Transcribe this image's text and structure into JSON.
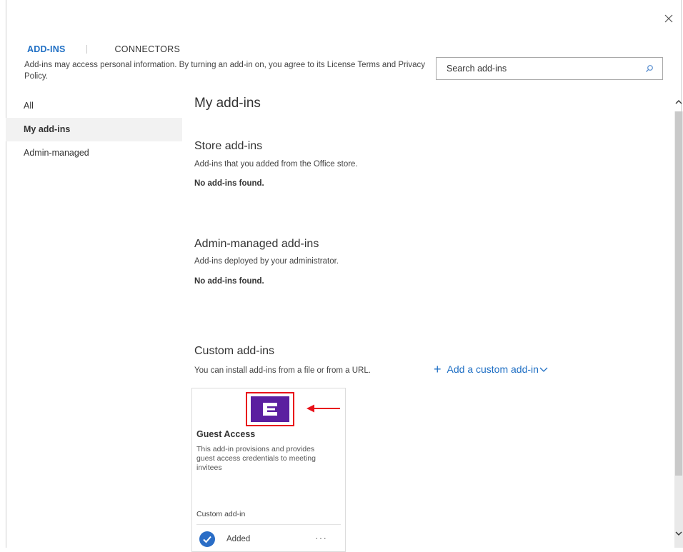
{
  "tabs": {
    "active": "ADD-INS",
    "other": "CONNECTORS"
  },
  "notice": "Add-ins may access personal information. By turning an add-in on, you agree to its License Terms and Privacy Policy.",
  "search": {
    "placeholder": "Search add-ins"
  },
  "sidebar": {
    "items": [
      {
        "label": "All"
      },
      {
        "label": "My add-ins"
      },
      {
        "label": "Admin-managed"
      }
    ]
  },
  "main": {
    "title": "My add-ins",
    "store": {
      "heading": "Store add-ins",
      "desc": "Add-ins that you added from the Office store.",
      "empty": "No add-ins found."
    },
    "admin": {
      "heading": "Admin-managed add-ins",
      "desc": "Add-ins deployed by your administrator.",
      "empty": "No add-ins found."
    },
    "custom": {
      "heading": "Custom add-ins",
      "desc": "You can install add-ins from a file or from a URL.",
      "add_label": "Add a custom add-in"
    }
  },
  "card": {
    "name": "Guest Access",
    "description": "This add-in provisions and provides guest access credentials to meeting invitees",
    "type": "Custom add-in",
    "status": "Added",
    "more": "···"
  },
  "colors": {
    "accent": "#1f6fc4",
    "logo": "#5b1fa0",
    "highlight": "#e8111a"
  }
}
